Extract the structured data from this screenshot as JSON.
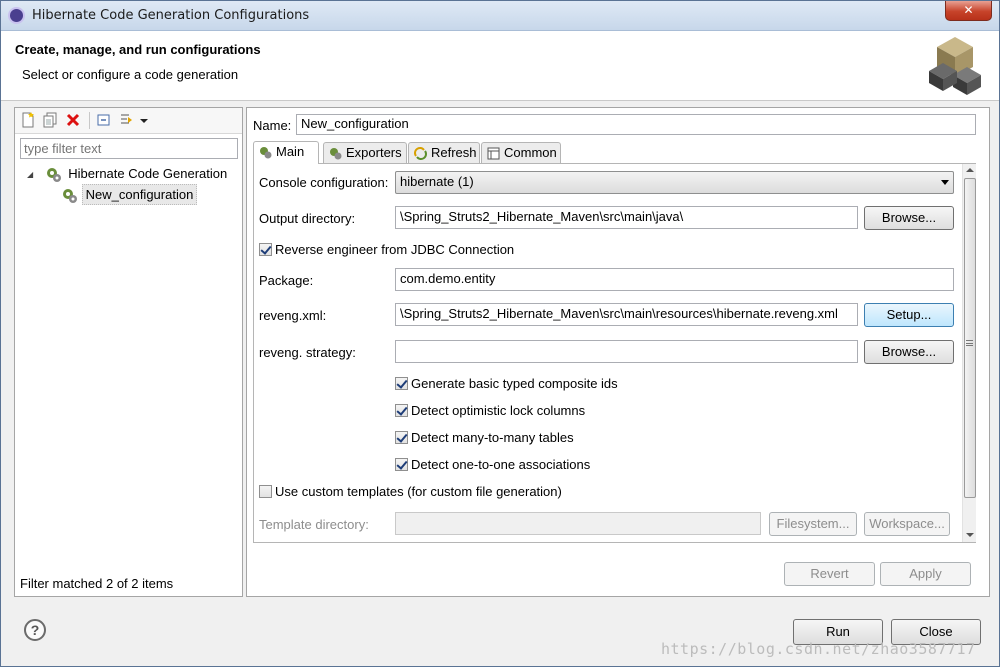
{
  "window": {
    "title": "Hibernate Code Generation Configurations",
    "close_glyph": "✕"
  },
  "banner": {
    "heading": "Create, manage, and run configurations",
    "subheading": "Select or configure a code generation"
  },
  "left": {
    "filter_placeholder": "type filter text",
    "tree": {
      "root": "Hibernate Code Generation",
      "child": "New_configuration",
      "expander": "◢"
    },
    "status": "Filter matched 2 of 2 items"
  },
  "right": {
    "name_label": "Name:",
    "name_value": "New_configuration",
    "tabs": [
      "Main",
      "Exporters",
      "Refresh",
      "Common"
    ],
    "main": {
      "console_label": "Console configuration:",
      "console_value": "hibernate (1)",
      "output_label": "Output directory:",
      "output_value": "\\Spring_Struts2_Hibernate_Maven\\src\\main\\java\\",
      "browse1": "Browse...",
      "reverse_label": "Reverse engineer from JDBC Connection",
      "package_label": "Package:",
      "package_value": "com.demo.entity",
      "reveng_label": "reveng.xml:",
      "reveng_value": "\\Spring_Struts2_Hibernate_Maven\\src\\main\\resources\\hibernate.reveng.xml",
      "setup": "Setup...",
      "strategy_label": "reveng. strategy:",
      "strategy_value": "",
      "browse2": "Browse...",
      "cb1": "Generate basic typed composite ids",
      "cb2": "Detect optimistic lock columns",
      "cb3": "Detect many-to-many tables",
      "cb4": "Detect one-to-one associations",
      "custom_templates": "Use custom templates (for custom file generation)",
      "template_dir_label": "Template directory:",
      "template_dir_value": "",
      "filesystem": "Filesystem...",
      "workspace": "Workspace..."
    },
    "revert": "Revert",
    "apply": "Apply"
  },
  "footer": {
    "help_glyph": "?",
    "run": "Run",
    "close": "Close",
    "watermark": "https://blog.csdn.net/zhao3587717"
  },
  "icons": {
    "app": "eclipse-icon",
    "logo": "hibernate-logo",
    "new": "new-config-icon",
    "duplicate": "duplicate-icon",
    "delete": "delete-icon",
    "collapse": "collapse-all-icon",
    "filter": "filter-icon",
    "help": "help-icon"
  }
}
